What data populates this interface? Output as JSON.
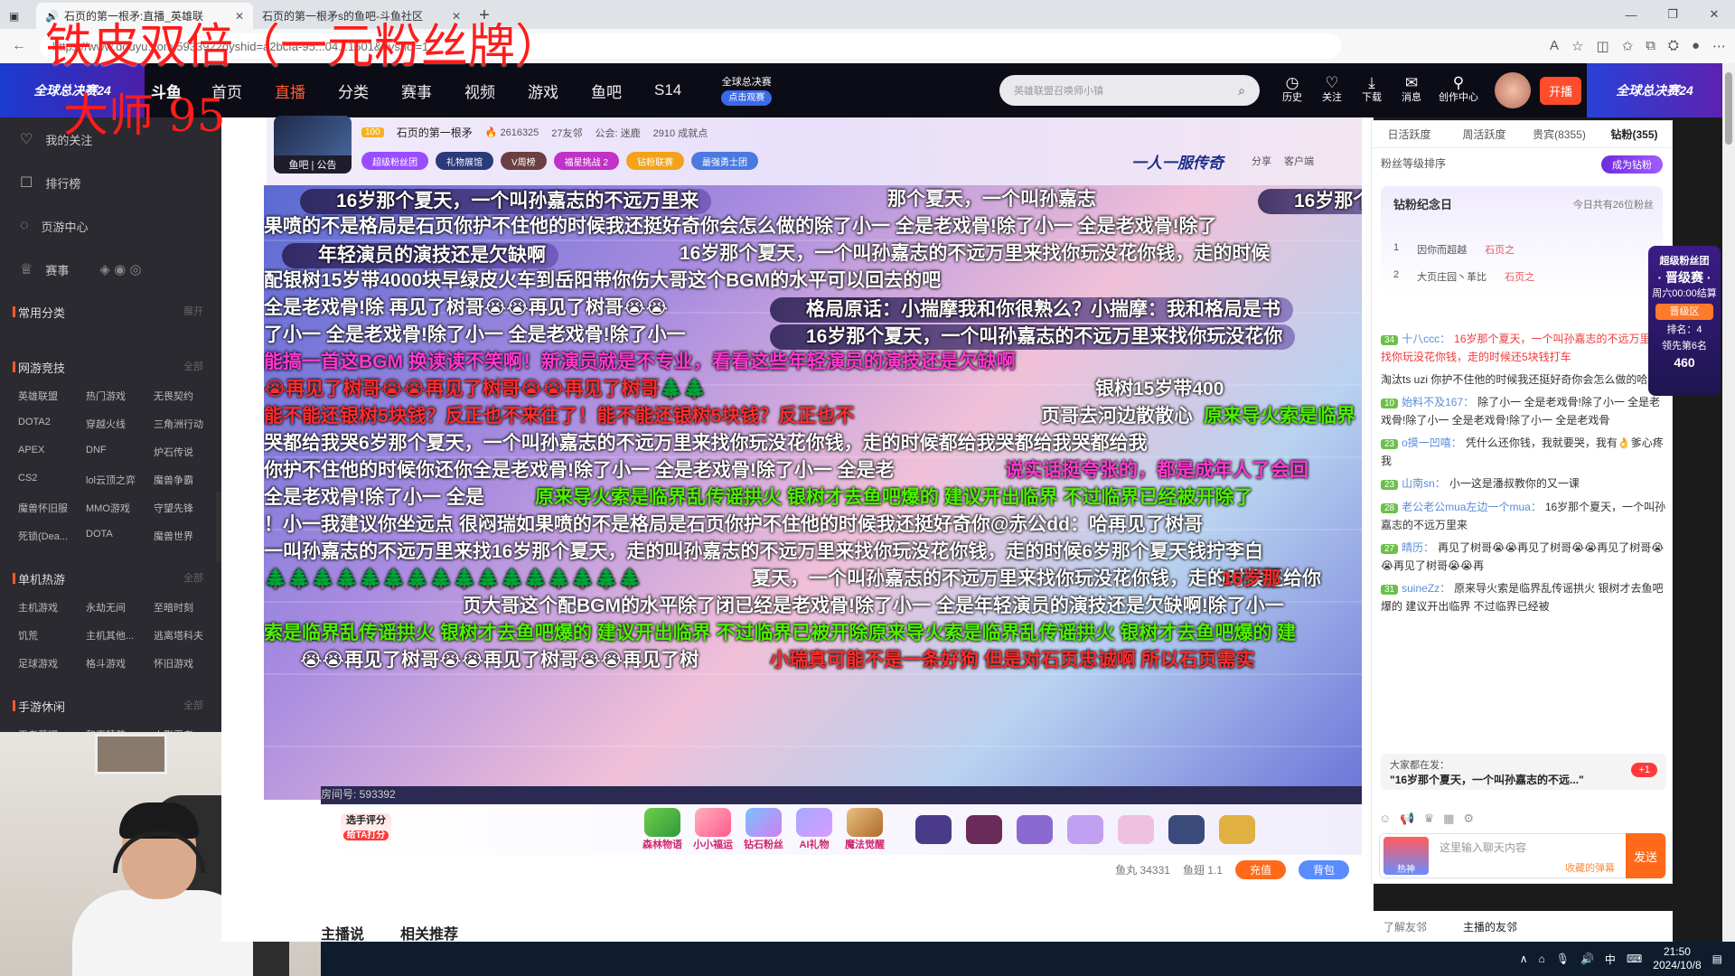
{
  "browser": {
    "tabs": [
      {
        "title": "石页的第一根矛:直播_英雄联"
      },
      {
        "title": "石页的第一根矛s的鱼吧-斗鱼社区"
      }
    ],
    "url": "https://www.douyu.com/5933922dyshid=a2bcfa-95...04...1601&dyshci=1"
  },
  "overlay": {
    "line1": "铁皮双倍（一元粉丝牌）",
    "line2": "大师 95"
  },
  "topnav": {
    "left_banner": "全球总决赛24",
    "brand": "斗鱼",
    "items": [
      "首页",
      "直播",
      "分类",
      "赛事",
      "视频",
      "游戏",
      "鱼吧",
      "S14"
    ],
    "worlds_title": "全球总决赛",
    "worlds_btn": "点击观赛",
    "search_placeholder": "英雄联盟召唤师小镇",
    "icons": [
      {
        "label": "历史",
        "icon": "clock-icon",
        "glyph": "◷"
      },
      {
        "label": "关注",
        "icon": "heart-icon",
        "glyph": "♡"
      },
      {
        "label": "下载",
        "icon": "download-icon",
        "glyph": "⤓"
      },
      {
        "label": "消息",
        "icon": "message-icon",
        "glyph": "✉"
      },
      {
        "label": "创作中心",
        "icon": "creator-icon",
        "glyph": "⚲"
      }
    ],
    "kaibo": "开播",
    "right_banner": "全球总决赛24"
  },
  "sidebar": {
    "items": [
      {
        "label": "我的关注",
        "icon": "heart-icon",
        "glyph": "♡"
      },
      {
        "label": "排行榜",
        "icon": "rank-icon",
        "glyph": "☐"
      },
      {
        "label": "页游中心",
        "icon": "game-icon",
        "glyph": "◌"
      },
      {
        "label": "赛事",
        "icon": "trophy-icon",
        "glyph": "♕"
      }
    ],
    "common": {
      "title": "常用分类",
      "more": "展开"
    },
    "sections": [
      {
        "title": "网游竞技",
        "more": "全部",
        "games": [
          "英雄联盟",
          "热门游戏",
          "无畏契约",
          "DOTA2",
          "穿越火线",
          "三角洲行动",
          "APEX",
          "DNF",
          "炉石传说",
          "CS2",
          "lol云顶之弈",
          "魔兽争霸",
          "魔兽怀旧服",
          "MMO游戏",
          "守望先锋",
          "死锁(Dea...",
          "DOTA",
          "魔兽世界"
        ]
      },
      {
        "title": "单机热游",
        "more": "全部",
        "games": [
          "主机游戏",
          "永劫无间",
          "至暗时刻",
          "饥荒",
          "主机其他...",
          "逃离塔科夫",
          "足球游戏",
          "格斗游戏",
          "怀旧游戏"
        ]
      },
      {
        "title": "手游休闲",
        "more": "全部",
        "games": [
          "王者荣耀",
          "和平精英",
          "火影忍者"
        ]
      }
    ]
  },
  "room": {
    "follow_btn": "鱼吧 | 公告",
    "name": "石页的第一根矛",
    "hot": "2616325",
    "friends": "27友邻",
    "union": "公会: 迷鹿",
    "achievement": "2910 成就点",
    "level": "100",
    "badges": [
      "超级粉丝团",
      "礼物展馆",
      "V周榜",
      "福星挑战 2",
      "钻粉联赛",
      "最强勇士团"
    ],
    "title": "一人一服传奇",
    "share": "分享",
    "client": "客户端",
    "room_id": "房间号: 593392"
  },
  "danmaku": [
    {
      "text": "16岁那个夏天，一个叫孙嘉志的不远万里来",
      "cls": "box"
    },
    {
      "text": "那个夏天，一个叫孙嘉志",
      "cls": ""
    },
    {
      "text": "16岁那个夏天",
      "cls": "box"
    },
    {
      "text": "果喷的不是格局是石页你护不住他的时候我还挺好奇你会怎么做的除了小一 全是老戏骨!除了小一 全是老戏骨!除了",
      "cls": ""
    },
    {
      "text": "年轻演员的演技还是欠缺啊",
      "cls": "box"
    },
    {
      "text": "16岁那个夏天，一个叫孙嘉志的不远万里来找你玩没花你钱，走的时候",
      "cls": ""
    },
    {
      "text": "配银树15岁带4000块早绿皮火车到岳阳带你伤大哥这个BGM的水平可以回去的吧",
      "cls": ""
    },
    {
      "text": "格局原话：小揣摩我和你很熟么？小揣摩：我和格局是书",
      "cls": "box"
    },
    {
      "text": "全是老戏骨!除 再见了树哥😭😭再见了树哥😭😭",
      "cls": ""
    },
    {
      "text": "了小一 全是老戏骨!除了小一 全是老戏骨!除了小一",
      "cls": ""
    },
    {
      "text": "16岁那个夏天，一个叫孙嘉志的不远万里来找你玩没花你",
      "cls": "box"
    },
    {
      "text": "能搞一首这BGM 换读读不笑啊！新演员就是不专业，看看这些年轻演员的演技还是欠缺啊",
      "cls": "m"
    },
    {
      "text": "😭再见了树哥😭😭再见了树哥😭😭再见了树哥🌲🌲",
      "cls": "r"
    },
    {
      "text": "银树15岁带400",
      "cls": ""
    },
    {
      "text": "能不能还银树5块钱？反正也不来往了！能不能还银树5块钱？反正也不",
      "cls": "r"
    },
    {
      "text": "页哥去河边散散心",
      "cls": ""
    },
    {
      "text": "原来导火索是临界",
      "cls": "g"
    },
    {
      "text": "哭都给我哭6岁那个夏天，一个叫孙嘉志的不远万里来找你玩没花你钱，走的时候都给我哭都给我哭都给我",
      "cls": ""
    },
    {
      "text": "你护不住他的时候你还你全是老戏骨!除了小一 全是老戏骨!除了小一 全是老",
      "cls": ""
    },
    {
      "text": "说实话挺夸张的，都是成年人了会回",
      "cls": "m"
    },
    {
      "text": "全是老戏骨!除了小一 全是",
      "cls": ""
    },
    {
      "text": "原来导火索是临界乱传谣拱火 银树才去鱼吧爆的 建议开出临界 不过临界已经被开除了",
      "cls": "g"
    },
    {
      "text": "！小一我建议你坐远点 很闷瑞如果喷的不是格局是石页你护不住他的时候我还挺好奇你@赤公dd：哈再见了树哥",
      "cls": ""
    },
    {
      "text": "一叫孙嘉志的不远万里来找16岁那个夏天，走的叫孙嘉志的不远万里来找你玩没花你钱，走的时候6岁那个夏天钱拧李白",
      "cls": ""
    },
    {
      "text": "🌲🌲🌲🌲🌲🌲🌲🌲🌲🌲🌲🌲🌲🌲🌲🌲",
      "cls": "g"
    },
    {
      "text": "夏天，一个叫孙嘉志的不远万里来找你玩没花你钱，走的时候还给你",
      "cls": ""
    },
    {
      "text": "16岁那",
      "cls": "r"
    },
    {
      "text": "页大哥这个配BGM的水平除了闭已经是老戏骨!除了小一 全是年轻演员的演技还是欠缺啊!除了小一",
      "cls": ""
    },
    {
      "text": "索是临界乱传谣拱火 银树才去鱼吧爆的 建议开出临界 不过临界已被开除原来导火索是临界乱传谣拱火 银树才去鱼吧爆的 建",
      "cls": "g"
    },
    {
      "text": "😭😭再见了树哥😭😭再见了树哥😭😭再见了树",
      "cls": ""
    },
    {
      "text": "小瑞真可能不是一条好狗 但是对石页忠诚啊 所以石页需实",
      "cls": "r"
    }
  ],
  "gifts": {
    "pick_title": "选手评分",
    "pick_btn": "给TA打分",
    "items": [
      "森林物语",
      "小小福运",
      "钻石粉丝",
      "AI礼物",
      "魔法觉醒"
    ],
    "yuwan": "鱼丸 34331",
    "yuchi": "鱼翅 1.1",
    "recharge": "充值",
    "bag": "背包"
  },
  "below": {
    "tab1": "主播说",
    "tab2": "相关推荐"
  },
  "rightpanel": {
    "tabs": [
      "日活跃度",
      "周活跃度",
      "贵宾(8355)",
      "钻粉(355)"
    ],
    "sort_label": "粉丝等级排序",
    "become": "成为钻粉",
    "memo_title": "钻粉纪念日",
    "memo_count": "今日共有26位粉丝",
    "memo_rows": [
      {
        "rank": "1",
        "name": "因你而超越",
        "tag": "石页之"
      },
      {
        "rank": "2",
        "name": "大页庄园丶革比",
        "tag": "石页之"
      }
    ],
    "chat": [
      {
        "lv": "34",
        "name": "十八ccc：",
        "text": "16岁那个夏天，一个叫孙嘉志的不远万里来找你玩没花你钱，走的时候还5块钱打车",
        "red": true
      },
      {
        "lv": "",
        "name": "",
        "text": "淘汰ts uzi 你护不住他的时候我还挺好奇你会怎么做的哈哈",
        "red": false
      },
      {
        "lv": "10",
        "name": "始料不及167：",
        "text": "除了小一 全是老戏骨!除了小一 全是老戏骨!除了小一 全是老戏骨!除了小一 全是老戏骨",
        "red": false
      },
      {
        "lv": "23",
        "name": "o摸一凹嘻：",
        "text": "凭什么还你钱，我就要哭，我有👌爹心疼我",
        "red": false
      },
      {
        "lv": "23",
        "name": "山南sn：",
        "text": "小一这是潘叔教你的又一课",
        "red": false
      },
      {
        "lv": "28",
        "name": "老公老公mua左边一个mua：",
        "text": "16岁那个夏天，一个叫孙嘉志的不远万里来",
        "red": false
      },
      {
        "lv": "27",
        "name": "晴历：",
        "text": "再见了树哥😭😭再见了树哥😭😭再见了树哥😭😭再见了树哥😭😭再",
        "red": false
      },
      {
        "lv": "31",
        "name": "suineZz：",
        "text": "原来导火索是临界乱传谣拱火 银树才去鱼吧爆的 建议开出临界 不过临界已经被",
        "red": false
      }
    ],
    "lotto_label": "大家都在发：",
    "lotto_text": "\"16岁那个夏天，一个叫孙嘉志的不远...\"",
    "lotto_plus": "+1",
    "hot_label": "热神",
    "input_placeholder": "这里输入聊天内容",
    "collect": "收藏的弹幕",
    "send": "发送",
    "bottom1": "了解友邻",
    "bottom2": "主播的友邻"
  },
  "fansrank": {
    "title": "超级粉丝团",
    "stage": "· 晋级赛 ·",
    "time": "周六00:00结算",
    "zone": "晋级区",
    "rank": "排名：4",
    "lead": "领先第6名",
    "num": "460"
  },
  "taskbar": {
    "time": "21:50",
    "date": "2024/10/8",
    "ime": "中"
  }
}
